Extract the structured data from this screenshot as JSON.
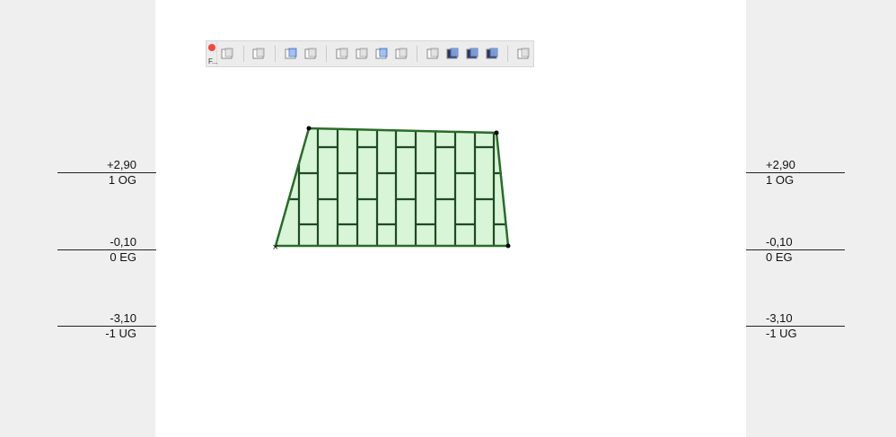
{
  "toolbar": {
    "close_color": "#f0473f",
    "grip_label": "F...",
    "groups": [
      [
        "grid-select-icon"
      ],
      [
        "frame-icon"
      ],
      [
        "grid-blue-icon",
        "grid-gray-icon"
      ],
      [
        "panel-cut-icon",
        "panel-box-icon",
        "panel-frame-icon",
        "panel-stack-icon"
      ],
      [
        "modules-icon",
        "pattern-dark-icon",
        "pattern-add-icon",
        "pattern-remove-icon"
      ],
      [
        "label-a1-icon"
      ]
    ]
  },
  "levels": [
    {
      "elevation": "+2,90",
      "name": "1 OG"
    },
    {
      "elevation": "-0,10",
      "name": "0 EG"
    },
    {
      "elevation": "-3,10",
      "name": "-1 UG"
    }
  ],
  "colors": {
    "fill": "#d8f5d8",
    "stroke": "#1f4a22",
    "outline": "#2a6b2a"
  }
}
